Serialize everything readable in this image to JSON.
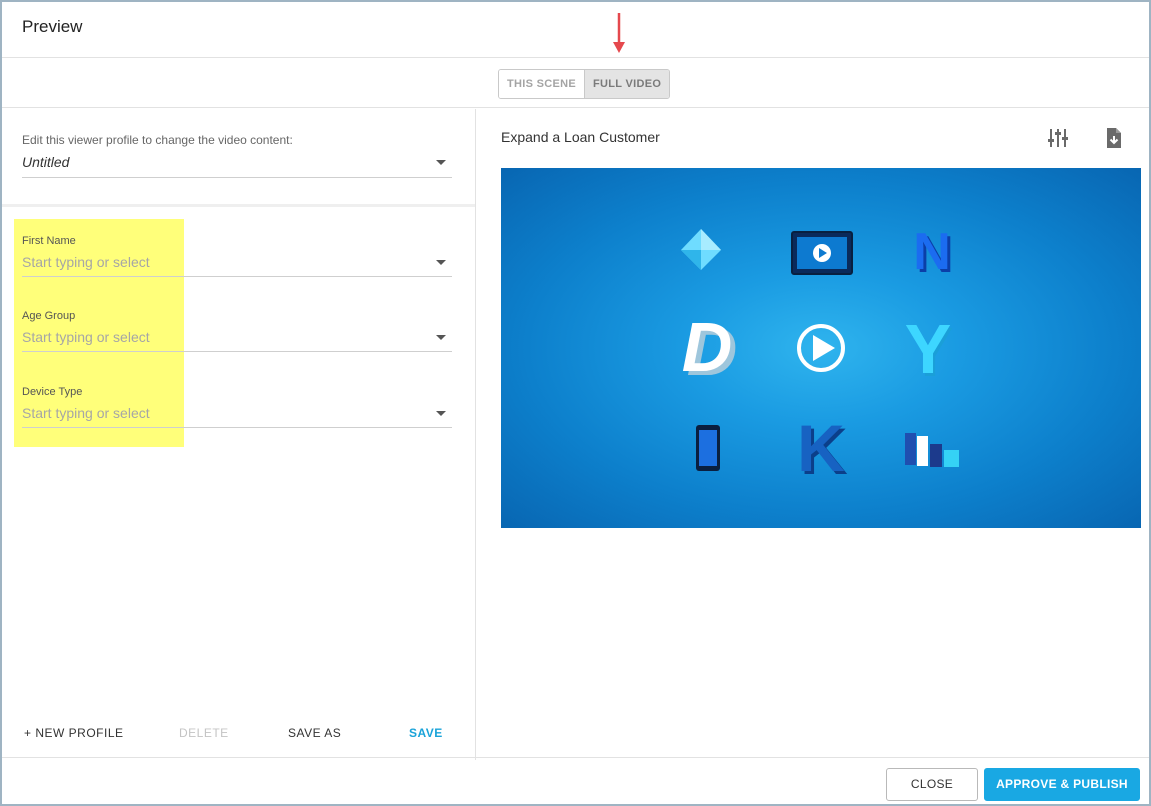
{
  "dialog": {
    "title": "Preview"
  },
  "toggle": {
    "options": [
      "THIS SCENE",
      "FULL VIDEO"
    ],
    "selected": "FULL VIDEO"
  },
  "profile": {
    "hint": "Edit this viewer profile to change the video content:",
    "value": "Untitled"
  },
  "fields": [
    {
      "label": "First Name",
      "placeholder": "Start typing or select"
    },
    {
      "label": "Age Group",
      "placeholder": "Start typing or select"
    },
    {
      "label": "Device Type",
      "placeholder": "Start typing or select"
    }
  ],
  "profile_actions": {
    "new_profile": "+ NEW PROFILE",
    "delete": "DELETE",
    "save_as": "SAVE AS",
    "save": "SAVE"
  },
  "video": {
    "title": "Expand a Loan Customer",
    "tools": [
      "sliders-icon",
      "download-file-icon"
    ],
    "tiles": [
      "diamond-icon",
      "video-screen-icon",
      "N",
      "D",
      "play-icon",
      "Y",
      "smartphone-icon",
      "K",
      "bar-chart-icon"
    ]
  },
  "footer": {
    "close": "CLOSE",
    "approve": "APPROVE & PUBLISH"
  },
  "colors": {
    "accent": "#19a8e3",
    "highlight": "#ffff7a",
    "annotation_arrow": "#e5484d"
  }
}
